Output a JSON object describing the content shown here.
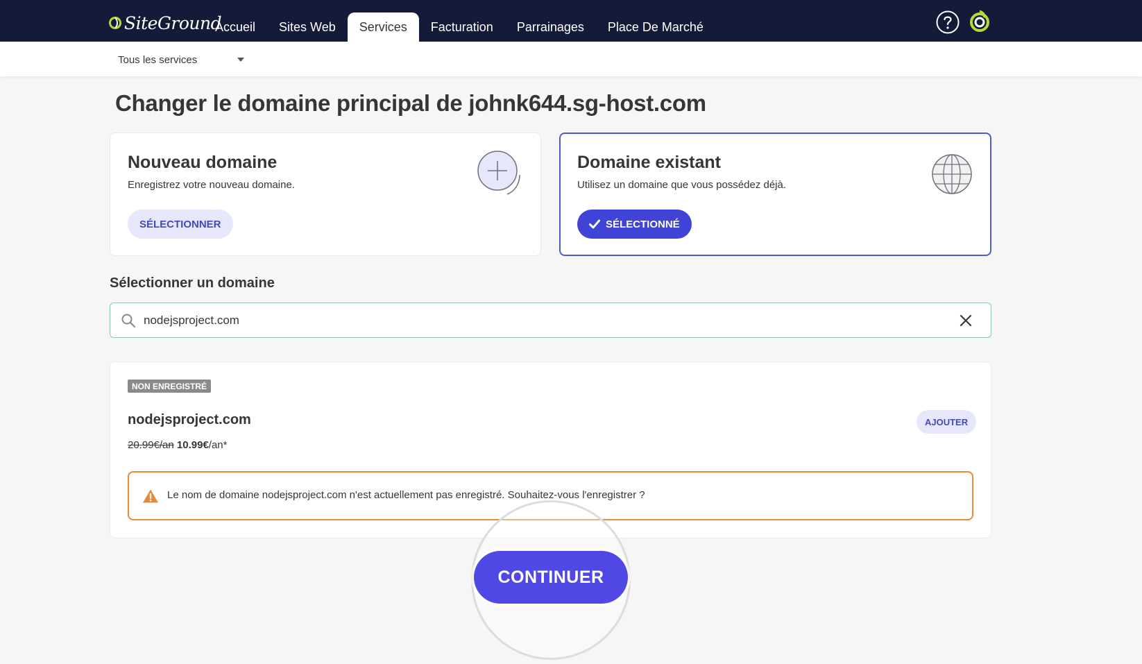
{
  "brand": {
    "name": "SiteGround",
    "accent": "#4044d6",
    "nav_bg": "#141a38"
  },
  "nav": {
    "items": [
      {
        "label": "Accueil",
        "active": false
      },
      {
        "label": "Sites Web",
        "active": false
      },
      {
        "label": "Services",
        "active": true
      },
      {
        "label": "Facturation",
        "active": false
      },
      {
        "label": "Parrainages",
        "active": false
      },
      {
        "label": "Place De Marché",
        "active": false
      }
    ],
    "icons": [
      "help-icon",
      "siteground-account-icon"
    ]
  },
  "subnav": {
    "service_select": "Tous les services"
  },
  "page": {
    "title": "Changer le domaine principal de johnk644.sg-host.com"
  },
  "options": {
    "new": {
      "title": "Nouveau domaine",
      "description": "Enregistrez votre nouveau domaine.",
      "button": "SÉLECTIONNER",
      "icon": "plus-circle-icon"
    },
    "existing": {
      "title": "Domaine existant",
      "description": "Utilisez un domaine que vous possédez déjà.",
      "button": "SÉLECTIONNÉ",
      "icon": "globe-icon",
      "selected": true
    }
  },
  "domain_select": {
    "label": "Sélectionner un domaine",
    "value": "nodejsproject.com"
  },
  "result": {
    "status_badge": "NON ENREGISTRÉ",
    "domain": "nodejsproject.com",
    "old_price": "20.99€/an",
    "new_price": "10.99€",
    "price_suffix": "/an*",
    "add_button": "AJOUTER",
    "alert": "Le nom de domaine nodejsproject.com n'est actuellement pas enregistré. Souhaitez-vous l'enregistrer ?"
  },
  "actions": {
    "continue": "CONTINUER"
  }
}
